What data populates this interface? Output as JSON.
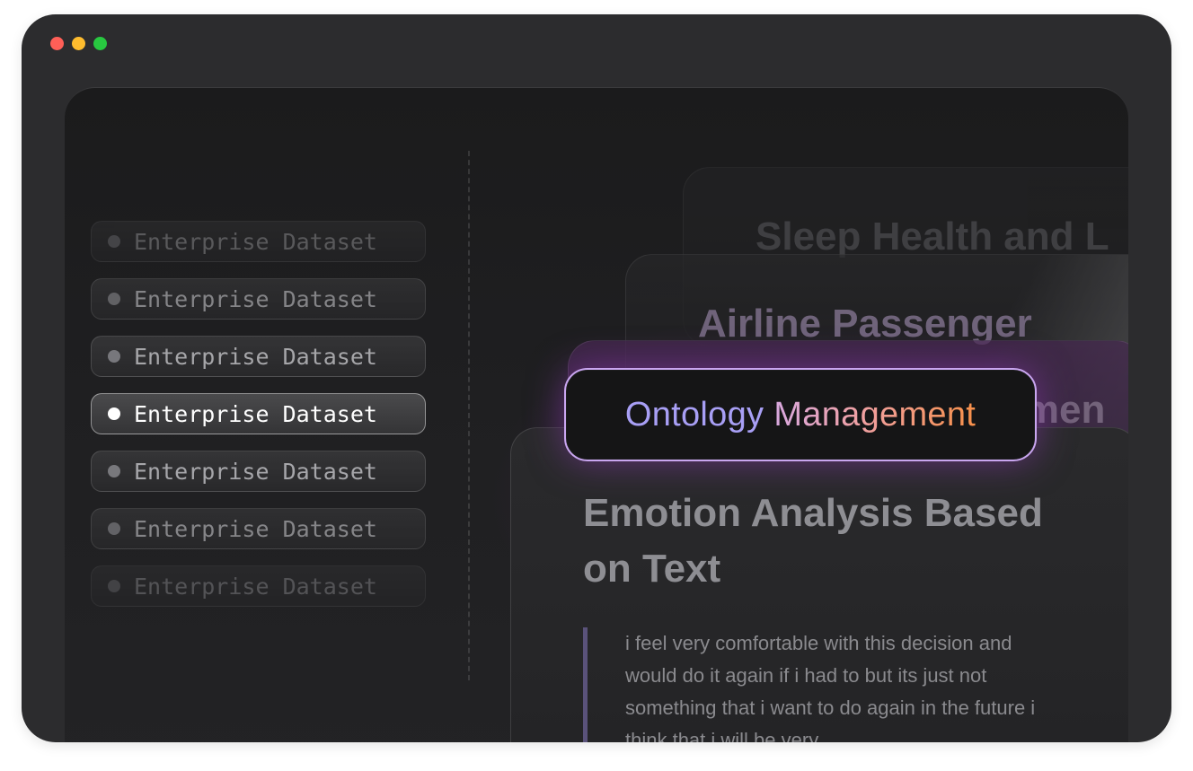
{
  "window": {
    "controls": [
      "close",
      "minimize",
      "maximize"
    ]
  },
  "datasets": {
    "items": [
      {
        "label": "Enterprise Dataset",
        "opacity": 0.35
      },
      {
        "label": "Enterprise Dataset",
        "opacity": 0.6
      },
      {
        "label": "Enterprise Dataset",
        "opacity": 0.8
      },
      {
        "label": "Enterprise Dataset",
        "opacity": 1.0,
        "active": true
      },
      {
        "label": "Enterprise Dataset",
        "opacity": 0.8
      },
      {
        "label": "Enterprise Dataset",
        "opacity": 0.6
      },
      {
        "label": "Enterprise Dataset",
        "opacity": 0.3
      }
    ]
  },
  "cards": {
    "card1_title": "Sleep Health and L",
    "card2_title": "Airline Passenger",
    "card3_title": "timen",
    "main": {
      "title": "Emotion Analysis Based on Text",
      "quote": "i feel very comfortable with this decision and would do it again if i had to but its just not something that i want to do again in the future i think that i will be very"
    }
  },
  "badge": {
    "word1": "Ontology",
    "word2": "Management"
  },
  "colors": {
    "close": "#ff5f57",
    "minimize": "#febc2e",
    "maximize": "#28c840",
    "badge_border": "#c9a6f0",
    "glow": "#8e34aa"
  }
}
